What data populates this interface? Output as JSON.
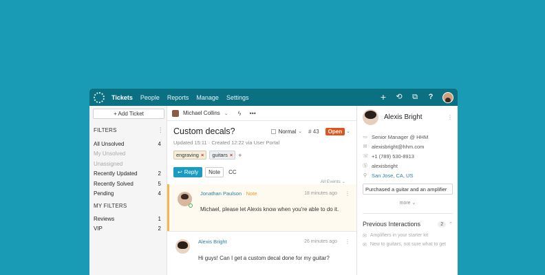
{
  "nav": {
    "items": [
      {
        "label": "Tickets",
        "active": true
      },
      {
        "label": "People"
      },
      {
        "label": "Reports"
      },
      {
        "label": "Manage"
      },
      {
        "label": "Settings"
      }
    ],
    "icons": [
      "plus-icon",
      "history-icon",
      "external-link-icon",
      "help-icon"
    ]
  },
  "sidebar": {
    "add_ticket": "+ Add Ticket",
    "filters_title": "FILTERS",
    "filters": [
      {
        "label": "All Unsolved",
        "count": "4"
      },
      {
        "label": "My Unsolved",
        "count": ""
      },
      {
        "label": "Unassigned",
        "count": ""
      },
      {
        "label": "Recently Updated",
        "count": "2"
      },
      {
        "label": "Recently Solved",
        "count": "5"
      },
      {
        "label": "Pending",
        "count": "4"
      }
    ],
    "my_filters_title": "MY FILTERS",
    "my_filters": [
      {
        "label": "Reviews",
        "count": "1"
      },
      {
        "label": "VIP",
        "count": "2"
      }
    ]
  },
  "ticket": {
    "assignee": "Michael Collins",
    "subject": "Custom decals?",
    "priority": "Normal",
    "number": "# 43",
    "status": "Open",
    "meta": "Updated 15:11 · Created 12:22 via User Portal",
    "tags": [
      "engraving",
      "guitars"
    ],
    "reply_label": "Reply",
    "note_label": "Note",
    "cc_label": "CC",
    "events_label": "All Events"
  },
  "messages": [
    {
      "author": "Jonathan Paulson",
      "type": "· Note",
      "time": "18 minutes ago",
      "body": "Michael, please let Alexis know when you're able to do it."
    },
    {
      "author": "Alexis Bright",
      "type": "",
      "time": "26 minutes ago",
      "body": "Hi guys! Can I get a custom decal done for my guitar?"
    }
  ],
  "contact": {
    "name": "Alexis Bright",
    "title": "Senior Manager @ HHM",
    "email": "alexisbright@hhm.com",
    "phone": "+1 (789) 530-8913",
    "skype": "alexisbright",
    "location": "San Jose, CA, US",
    "note": "Purchased a guitar and an amplifier",
    "more": "more",
    "previous_title": "Previous Interactions",
    "previous_count": "2",
    "previous": [
      "Amplifiers in your starter kit",
      "New to guitars, not sure what to get"
    ]
  },
  "colors": {
    "background": "#1a9bb5",
    "nav": "#0b7182",
    "status_open": "#e0541c",
    "reply": "#1a9bc2",
    "note_border": "#f4b54a"
  }
}
